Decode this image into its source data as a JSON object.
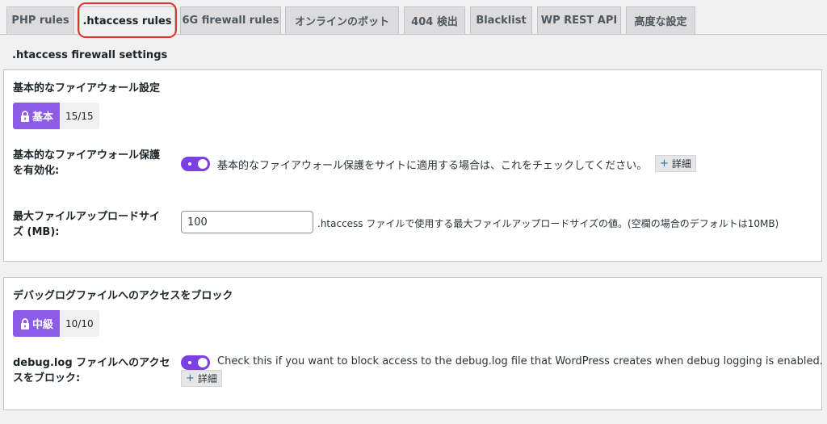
{
  "tabs": [
    {
      "label": "PHP rules"
    },
    {
      "label": ".htaccess rules"
    },
    {
      "label": "6G firewall rules"
    },
    {
      "label": "オンラインのボット"
    },
    {
      "label": "404 検出"
    },
    {
      "label": "Blacklist"
    },
    {
      "label": "WP REST API"
    },
    {
      "label": "高度な設定"
    }
  ],
  "active_tab": ".htaccess rules",
  "section_title": ".htaccess firewall settings",
  "panels": [
    {
      "title": "基本的なファイアウォール設定",
      "badge": {
        "level": "基本",
        "count": "15/15"
      },
      "toggle_field": {
        "label_line1": "基本的なファイアウォール保護",
        "label_line2": "を有効化:",
        "checked": true,
        "description": "基本的なファイアウォール保護をサイトに適用する場合は、これをチェックしてください。",
        "more_label": "詳細"
      },
      "size_field": {
        "label_line1": "最大ファイルアップロードサイ",
        "label_line2": "ズ (MB):",
        "value": "100",
        "description": ".htaccess ファイルで使用する最大ファイルアップロードサイズの値。(空欄の場合のデフォルトは10MB)"
      }
    },
    {
      "title": "デバッグログファイルへのアクセスをブロック",
      "badge": {
        "level": "中級",
        "count": "10/10"
      },
      "toggle_field": {
        "label_line1": "debug.log ファイルへのアクセ",
        "label_line2": "スをブロック:",
        "checked": true,
        "description": "Check this if you want to block access to the debug.log file that WordPress creates when debug logging is enabled.",
        "more_label": "詳細"
      }
    }
  ],
  "colors": {
    "accent": "#8d5ce6",
    "toggle_on": "#7b3fe4",
    "highlight": "#e0322f",
    "page_bg": "#f0f0f1"
  }
}
